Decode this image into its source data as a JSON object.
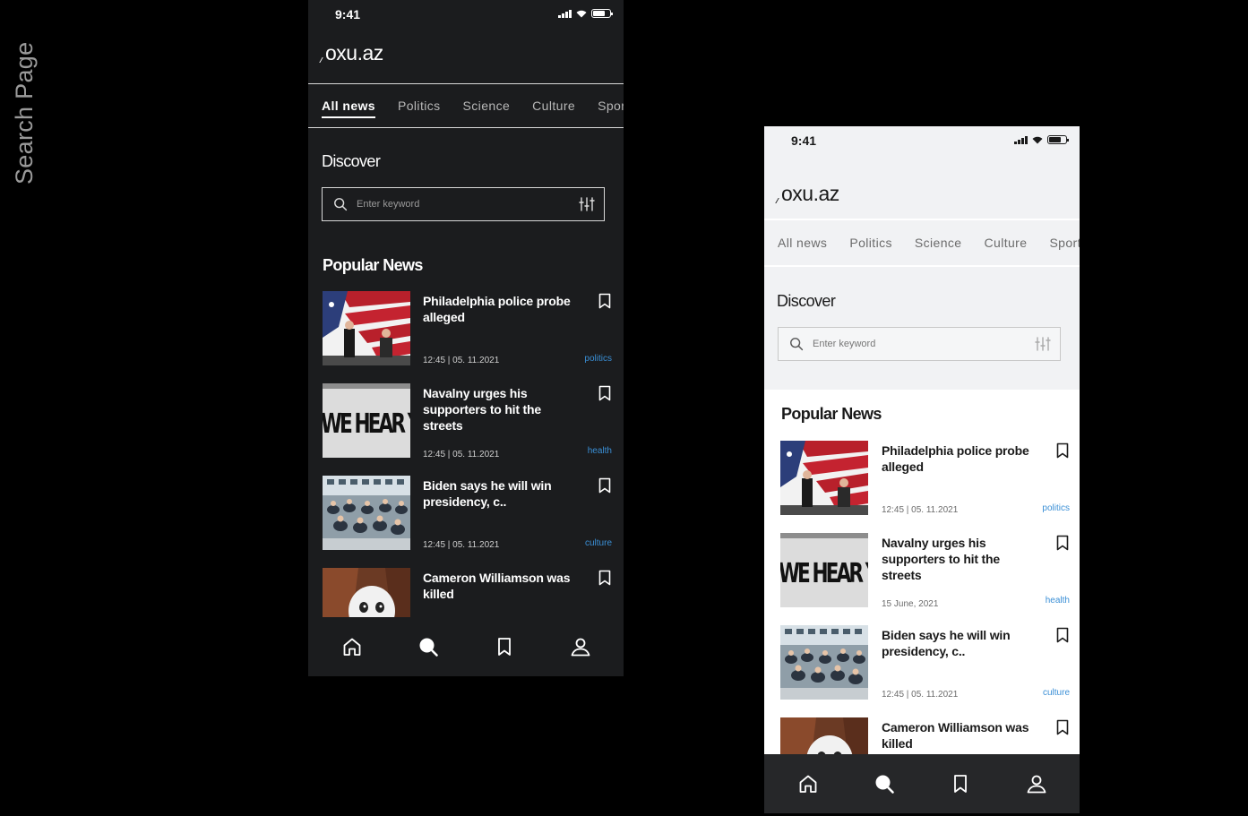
{
  "page_label": "Search Page",
  "status_bar": {
    "time": "9:41"
  },
  "app": {
    "logo": "oxu.az"
  },
  "tabs": [
    {
      "label": "All news"
    },
    {
      "label": "Politics"
    },
    {
      "label": "Science"
    },
    {
      "label": "Culture"
    },
    {
      "label": "Sports"
    }
  ],
  "discover": {
    "title": "Discover",
    "search_placeholder": "Enter keyword"
  },
  "popular": {
    "title": "Popular News",
    "dark_items": [
      {
        "title": "Philadelphia police probe alleged",
        "meta": "12:45  |  05. 11.2021",
        "category": "politics"
      },
      {
        "title": "Navalny urges his supporters to hit the streets",
        "meta": "12:45  |  05. 11.2021",
        "category": "health"
      },
      {
        "title": "Biden says he will win presidency, c..",
        "meta": "12:45  |  05. 11.2021",
        "category": "culture"
      },
      {
        "title": "Cameron Williamson was killed",
        "meta": "",
        "category": ""
      }
    ],
    "light_items": [
      {
        "title": "Philadelphia police probe alleged",
        "meta": "12:45  |  05. 11.2021",
        "category": "politics"
      },
      {
        "title": "Navalny urges his supporters to hit the streets",
        "meta": "15 June, 2021",
        "category": "health"
      },
      {
        "title": "Biden says he will win presidency, c..",
        "meta": "12:45  |  05. 11.2021",
        "category": "culture"
      },
      {
        "title": "Cameron Williamson was killed",
        "meta": "",
        "category": ""
      }
    ]
  },
  "thumb_text": {
    "we_hear_you": "WE HEAR YOU"
  },
  "colors": {
    "accent": "#3a8fd6",
    "dark_bg": "#1b1c1e",
    "light_top": "#f1f2f4"
  },
  "nav": [
    {
      "icon": "home-icon"
    },
    {
      "icon": "search-icon"
    },
    {
      "icon": "bookmark-icon"
    },
    {
      "icon": "profile-icon"
    }
  ]
}
